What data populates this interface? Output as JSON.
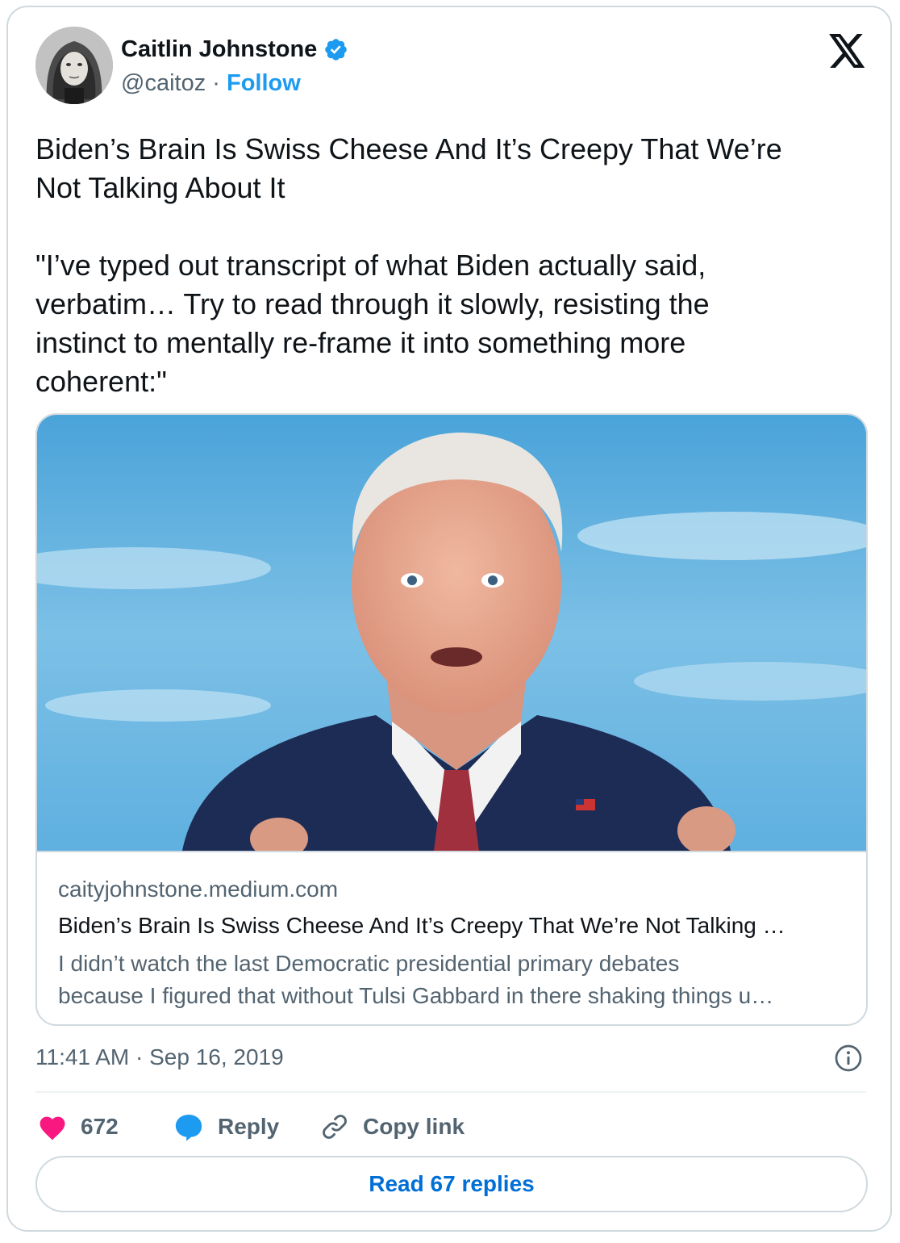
{
  "author": {
    "name": "Caitlin Johnstone",
    "handle": "@caitoz",
    "separator": "·",
    "follow_label": "Follow"
  },
  "tweet": {
    "text": "Biden’s Brain Is Swiss Cheese And It’s Creepy That We’re\nNot Talking About It\n\n\"I’ve typed out transcript of what Biden actually said,\nverbatim… Try to read through it slowly, resisting the\ninstinct to mentally re-frame it into something more\ncoherent:\""
  },
  "link_card": {
    "domain": "caityjohnstone.medium.com",
    "title": "Biden’s Brain Is Swiss Cheese And It’s Creepy That We’re Not Talking …",
    "description_line1": "I didn’t watch the last Democratic presidential primary debates",
    "description_line2": "because I figured that without Tulsi Gabbard in there shaking things u…"
  },
  "meta": {
    "timestamp": "11:41 AM · Sep 16, 2019"
  },
  "actions": {
    "like_count": "672",
    "reply_label": "Reply",
    "copy_link_label": "Copy link"
  },
  "read_replies_label": "Read 67 replies",
  "colors": {
    "accent": "#1d9bf0",
    "like": "#f91880",
    "muted_text": "#536471",
    "border": "#cfd9de"
  },
  "icons": [
    "verified-badge-icon",
    "x-logo-icon",
    "info-icon",
    "heart-icon",
    "reply-bubble-icon",
    "link-icon"
  ]
}
